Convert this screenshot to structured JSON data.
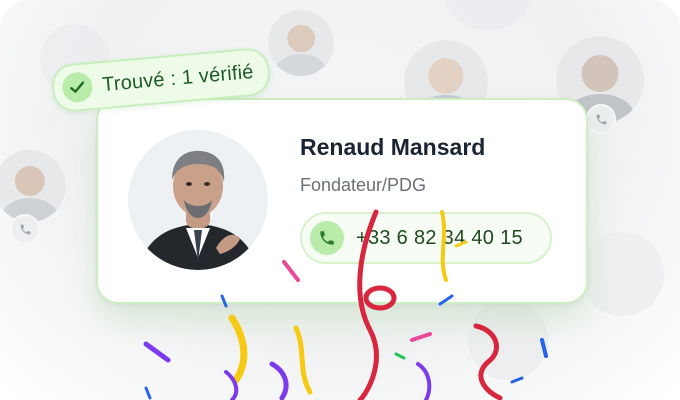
{
  "badge": {
    "label": "Trouvé : 1 vérifié",
    "icon": "check-icon",
    "accent": "#2f8a32"
  },
  "contact": {
    "name": "Renaud Mansard",
    "title": "Fondateur/PDG",
    "phone": "+33 6 82 34 40 15",
    "phone_icon": "phone-icon"
  },
  "colors": {
    "green_accent": "#4caf3f",
    "green_soft": "#b9ecaa",
    "card_border": "#cdeec2",
    "confetti": [
      "#d7263d",
      "#f6c913",
      "#7c3aed",
      "#2563eb",
      "#ec4899",
      "#22c55e"
    ]
  }
}
